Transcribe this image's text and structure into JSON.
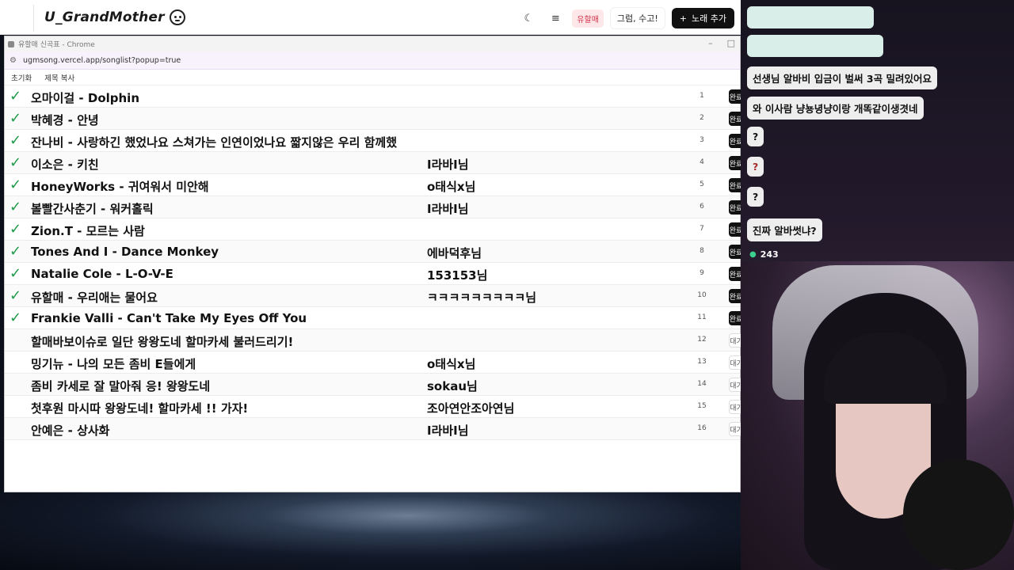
{
  "header": {
    "brand": "U_GrandMother",
    "user_badge": "유할매",
    "ghost_button": "그럼, 수고!",
    "add_button": "노래 추가"
  },
  "popup": {
    "window_title": "유할매 신곡표 - Chrome",
    "url": "ugmsong.vercel.app/songlist?popup=true",
    "toolbar": [
      "초기화",
      "제목 복사"
    ]
  },
  "songs": [
    {
      "title": "오마이걸 - Dolphin",
      "requester": "",
      "num": "1",
      "done": true,
      "status": "완료"
    },
    {
      "title": "박혜경 - 안녕",
      "requester": "",
      "num": "2",
      "done": true,
      "status": "완료"
    },
    {
      "title": "잔나비 - 사랑하긴 했었나요 스쳐가는 인연이었나요 짧지않은 우리 함께했",
      "requester": "",
      "num": "3",
      "done": true,
      "status": "완료"
    },
    {
      "title": "이소은 - 키친",
      "requester": "I라바I님",
      "num": "4",
      "done": true,
      "status": "완료"
    },
    {
      "title": "HoneyWorks - 귀여워서 미안해",
      "requester": "o태식x님",
      "num": "5",
      "done": true,
      "status": "완료"
    },
    {
      "title": "볼빨간사춘기 - 워커홀릭",
      "requester": "I라바I님",
      "num": "6",
      "done": true,
      "status": "완료"
    },
    {
      "title": "Zion.T - 모르는 사람",
      "requester": "",
      "num": "7",
      "done": true,
      "status": "완료"
    },
    {
      "title": "Tones And I - Dance Monkey",
      "requester": "에바덕후님",
      "num": "8",
      "done": true,
      "status": "완료"
    },
    {
      "title": "Natalie Cole - L-O-V-E",
      "requester": "153153님",
      "num": "9",
      "done": true,
      "status": "완료"
    },
    {
      "title": "유할매 - 우리애는 물어요",
      "requester": "ㅋㅋㅋㅋㅋㅋㅋㅋㅋ님",
      "num": "10",
      "done": true,
      "status": "완료"
    },
    {
      "title": "Frankie Valli - Can't Take My Eyes Off You",
      "requester": "",
      "num": "11",
      "done": true,
      "status": "완료"
    },
    {
      "title": "할매바보이슈로 일단 왕왕도네 할마카세 불러드리기!",
      "requester": "",
      "num": "12",
      "done": false,
      "status": "대기"
    },
    {
      "title": "밍기뉴 - 나의 모든 좀비 E들에게",
      "requester": "o태식x님",
      "num": "13",
      "done": false,
      "status": "대기"
    },
    {
      "title": "좀비 카세로 잘 말아줘 응! 왕왕도네",
      "requester": "sokau님",
      "num": "14",
      "done": false,
      "status": "대기"
    },
    {
      "title": "첫후원 마시따 왕왕도네! 할마카세 !! 가자!",
      "requester": "조아연안조아연님",
      "num": "15",
      "done": false,
      "status": "대기"
    },
    {
      "title": "안예은 - 상사화",
      "requester": "I라바I님",
      "num": "16",
      "done": false,
      "status": "대기"
    }
  ],
  "chat": {
    "messages": [
      {
        "text": "선생님 알바비 입금이 벌써 3곡 밀려있어요",
        "style": "normal"
      },
      {
        "text": "와 이사람 냥뇽녕냥이랑 개똑같이생겻네",
        "style": "normal"
      },
      {
        "text": "?",
        "style": "normal"
      },
      {
        "text": "?",
        "style": "red"
      },
      {
        "text": "?",
        "style": "normal"
      },
      {
        "text": "진짜 알바썻냐?",
        "style": "normal"
      }
    ],
    "viewer_count": "243"
  },
  "colors": {
    "check_green": "#1e9b4b",
    "badge_red": "#d1344a",
    "primary_dark": "#111111"
  }
}
